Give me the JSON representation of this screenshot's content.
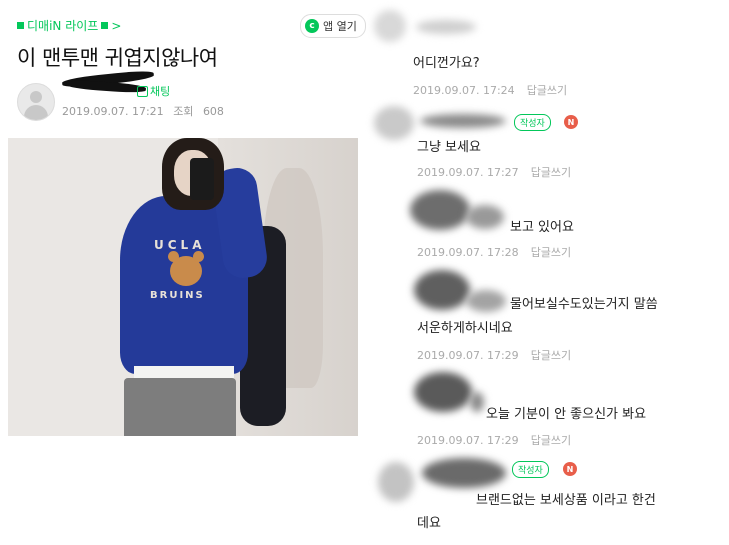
{
  "post": {
    "cafe_name": "디매iN 라이프",
    "cafe_chevron": ">",
    "app_button": "앱 열기",
    "title": "이 맨투맨 귀엽지않나여",
    "chat_label": "채팅",
    "date": "2019.09.07. 17:21",
    "views_label": "조회",
    "views": "608"
  },
  "photo": {
    "print_top": "UCLA",
    "print_bottom": "BRUINS"
  },
  "comments": [
    {
      "text": "어디껀가요?",
      "time": "2019.09.07. 17:24",
      "reply": "답글쓰기",
      "is_author": false
    },
    {
      "text": "그냥 보세요",
      "time": "2019.09.07. 17:27",
      "reply": "답글쓰기",
      "is_author": true
    },
    {
      "text": "보고 있어요",
      "time": "2019.09.07. 17:28",
      "reply": "답글쓰기",
      "is_author": false
    },
    {
      "text_line1": "물어보실수도있는거지 말씀",
      "text_line2": "서운하게하시네요",
      "time": "2019.09.07. 17:29",
      "reply": "답글쓰기",
      "is_author": false
    },
    {
      "text": "오늘 기분이 안 좋으신가 봐요",
      "time": "2019.09.07. 17:29",
      "reply": "답글쓰기",
      "is_author": false
    },
    {
      "text_line1": "브랜드없는 보세상품 이라고 한건",
      "text_line2": "데요",
      "is_author": true
    }
  ],
  "badges": {
    "author": "작성자",
    "new": "N"
  }
}
